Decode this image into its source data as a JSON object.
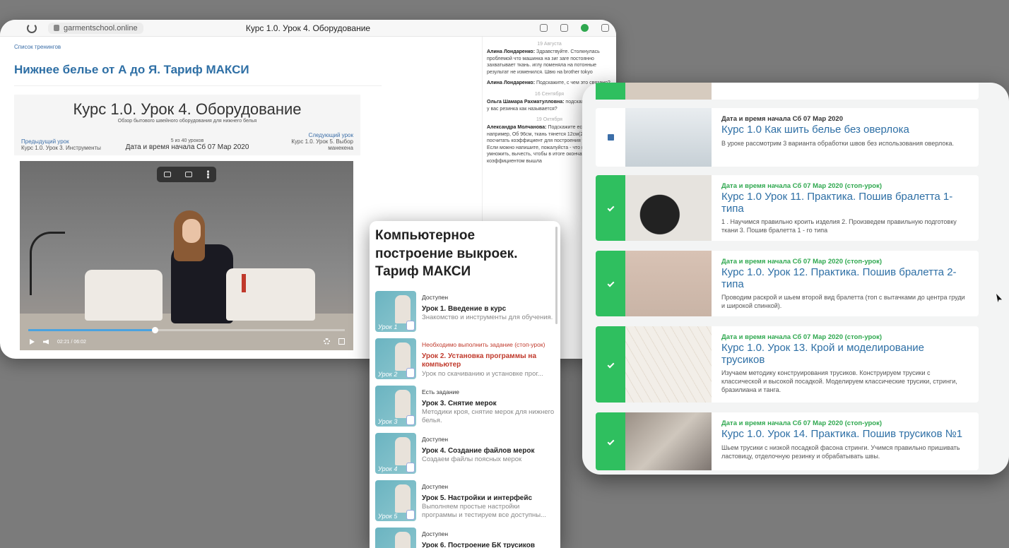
{
  "browser": {
    "url": "garmentschool.online",
    "tab_title": "Курс 1.0. Урок 4. Оборудование",
    "breadcrumb": "Список тренингов",
    "course_title": "Нижнее белье от А до Я. Тариф МАКСИ",
    "lesson": {
      "heading": "Курс 1.0. Урок 4. Оборудование",
      "subtitle": "Обзор бытового швейного оборудования для нижнего белья",
      "prev_label": "Предыдущий урок",
      "prev_name": "Курс 1.0. Урок 3. Инструменты",
      "count": "5 из 40 уроков",
      "date": "Дата и время начала Сб 07 Мар 2020",
      "next_label": "Следующий урок",
      "next_name": "Курс 1.0. Урок 5. Выбор манекена"
    },
    "video": {
      "time": "02:21 / 06:02",
      "progress": 0.4
    },
    "chat": [
      {
        "date": "19 Августа",
        "author": "Алина Лондаренко:",
        "text": "Здравствуйте. Столкнулась проблемой что машинка на зиг заге постоянно захватывает ткань. иглу поменяла на потонные результат не изменился. Швю на brother tokyo"
      },
      {
        "date": "",
        "author": "Алина Лондаренко:",
        "text": "Подскажите, с чем это связано?"
      },
      {
        "date": "16 Сентября",
        "author": "Ольга Шамара Рахматулловна:",
        "text": "подскажите сколько у вас резинка как называется?"
      },
      {
        "date": "19 Октября",
        "author": "Александра Молчанова:",
        "text": "Подскажите если например, Об 96см, ткань тянется 12см(20%) как посчитать коэффициент для построения трусиков? Если можно напишите, пожалуйста - что на что умножить, вычесть, чтобы в итоге окончательный коэффициентом вышла"
      }
    ]
  },
  "mid_panel": {
    "title": "Компьютерное построение выкроек. Тариф МАКСИ",
    "items": [
      {
        "status": "Доступен",
        "status_warn": false,
        "name": "Урок 1. Введение в курс",
        "desc": "Знакомство и инструменты для обучения.",
        "thumb_label": "Урок 1"
      },
      {
        "status": "Необходимо выполнить задание (стоп-урок)",
        "status_warn": true,
        "name": "Урок 2. Установка программы на компьютер",
        "desc": "Урок по скачиванию и установке прог...",
        "thumb_label": "Урок 2"
      },
      {
        "status": "Есть задание",
        "status_warn": false,
        "name": "Урок 3. Снятие мерок",
        "desc": "Методики кроя, снятие мерок для нижнего белья.",
        "thumb_label": "Урок 3"
      },
      {
        "status": "Доступен",
        "status_warn": false,
        "name": "Урок 4. Создание файлов мерок",
        "desc": "Создаем файлы поясных мерок",
        "thumb_label": "Урок 4"
      },
      {
        "status": "Доступен",
        "status_warn": false,
        "name": "Урок 5. Настройки и интерфейс",
        "desc": "Выполняем простые настройки программы и тестируем все доступны...",
        "thumb_label": "Урок 5"
      },
      {
        "status": "Доступен",
        "status_warn": false,
        "name": "Урок 6. Построение БК трусиков",
        "desc": "",
        "thumb_label": "Урок 6"
      }
    ]
  },
  "right_panel": {
    "items": [
      {
        "date": "Дата и время начала Сб 07 Мар 2020",
        "date_green": false,
        "done": false,
        "title": "Курс 1.0 Как шить белье без оверлока",
        "desc": "В уроке рассмотрим 3 варианта обработки швов без использования оверлока.",
        "img": "over"
      },
      {
        "date": "Дата и время начала Сб 07 Мар 2020 (стоп-урок)",
        "date_green": true,
        "done": true,
        "title": "Курс 1.0 Урок 11. Практика. Пошив бралетта 1-типа",
        "desc": "1 . Научимся правильно кроить изделия 2. Произведем правильную подготовку ткани 3. Пошив бралетта 1 - го типа",
        "img": "lace"
      },
      {
        "date": "Дата и время начала Сб 07 Мар 2020 (стоп-урок)",
        "date_green": true,
        "done": true,
        "title": "Курс 1.0. Урок 12. Практика. Пошив бралетта 2-типа",
        "desc": "Проводим раскрой и шьем второй вид бралетта (топ с вытачками до центра груди и широкой спинкой).",
        "img": "lace2"
      },
      {
        "date": "Дата и время начала Сб 07 Мар 2020 (стоп-урок)",
        "date_green": true,
        "done": true,
        "title": "Курс 1.0. Урок 13. Крой и моделирование трусиков",
        "desc": "Изучаем методику конструирования трусиков. Конструируем трусики с классической и высокой посадкой. Моделируем классические трусики, стринги, бразилиана и танга.",
        "img": "draw"
      },
      {
        "date": "Дата и время начала Сб 07 Мар 2020 (стоп-урок)",
        "date_green": true,
        "done": true,
        "title": "Курс 1.0. Урок 14. Практика. Пошив трусиков №1",
        "desc": "Шьем трусики с низкой посадкой фасона стринги. Учимся правильно пришивать ластовицу, отделочную резинку и обрабатывать швы.",
        "img": "fab"
      }
    ]
  }
}
